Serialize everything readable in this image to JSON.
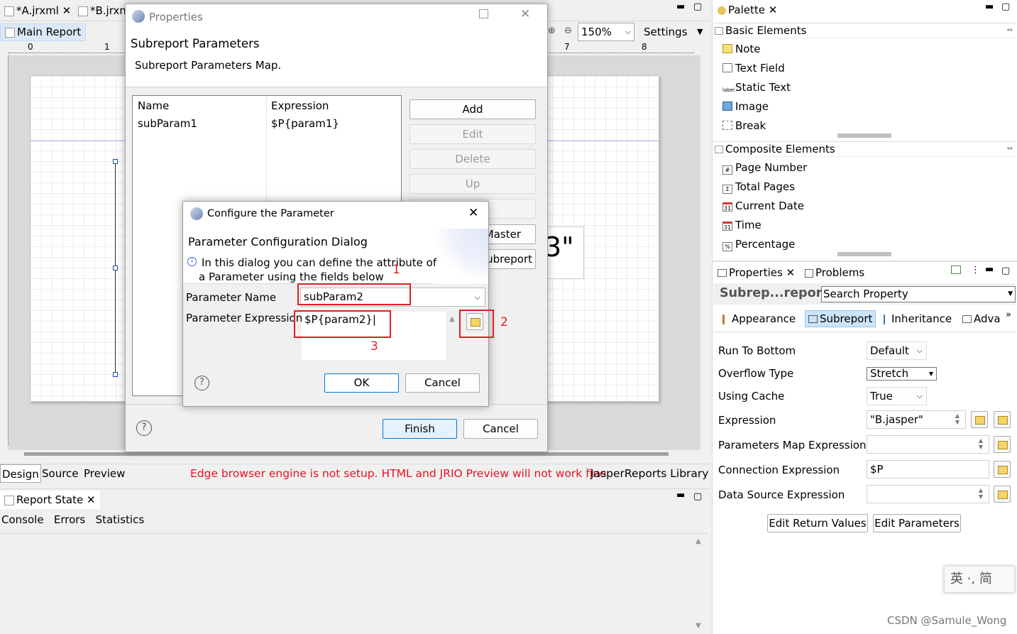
{
  "editor": {
    "tabs": [
      {
        "label": "*A.jrxml"
      },
      {
        "label": "*B.jrxm"
      }
    ],
    "subtab": "Main Report",
    "zoom": "150%",
    "settings": "Settings",
    "ruler_labels": [
      "0",
      "1",
      "7",
      "8"
    ],
    "preview_text": "3\"",
    "bottom_tabs": [
      "Design",
      "Source",
      "Preview"
    ],
    "warning": "Edge browser engine is not setup. HTML and JRIO Preview will not work fine",
    "library": "JasperReports Library"
  },
  "report_state": {
    "title": "Report State",
    "tabs": [
      "Console",
      "Errors",
      "Statistics"
    ]
  },
  "palette": {
    "title": "Palette",
    "basic_title": "Basic Elements",
    "basic": [
      {
        "label": "Note",
        "icon": "note-icon"
      },
      {
        "label": "Text Field",
        "icon": "text-field-icon"
      },
      {
        "label": "Static Text",
        "icon": "static-text-icon"
      },
      {
        "label": "Image",
        "icon": "image-icon"
      },
      {
        "label": "Break",
        "icon": "break-icon"
      }
    ],
    "composite_title": "Composite Elements",
    "composite": [
      {
        "label": "Page Number",
        "icon": "hash-icon",
        "glyph": "#"
      },
      {
        "label": "Total Pages",
        "icon": "sigma-icon",
        "glyph": "Σ"
      },
      {
        "label": "Current Date",
        "icon": "calendar-icon",
        "glyph": "31"
      },
      {
        "label": "Time",
        "icon": "calendar-icon",
        "glyph": "31"
      },
      {
        "label": "Percentage",
        "icon": "percent-icon",
        "glyph": "%"
      }
    ]
  },
  "properties_view": {
    "tabs": [
      "Properties",
      "Problems"
    ],
    "element_title": "Subrep...report",
    "search_placeholder": "Search Property",
    "section_tabs": [
      "Appearance",
      "Subreport",
      "Inheritance",
      "Adva"
    ],
    "fields": [
      {
        "label": "Run To Bottom",
        "value": "Default"
      },
      {
        "label": "Overflow Type",
        "value": "Stretch"
      },
      {
        "label": "Using Cache",
        "value": "True"
      },
      {
        "label": "Expression",
        "value": "\"B.jasper\""
      },
      {
        "label": "Parameters Map Expression",
        "value": ""
      },
      {
        "label": "Connection Expression",
        "value": "$P"
      },
      {
        "label": "Data Source Expression",
        "value": ""
      }
    ],
    "edit_return_values": "Edit Return Values",
    "edit_parameters": "Edit Parameters"
  },
  "properties_dialog": {
    "title": "Properties",
    "heading": "Subreport Parameters",
    "subheading": "Subreport Parameters Map.",
    "columns": [
      "Name",
      "Expression"
    ],
    "rows": [
      {
        "name": "subParam1",
        "expression": "$P{param1}"
      }
    ],
    "buttons": {
      "add": "Add",
      "edit": "Edit",
      "delete": "Delete",
      "up": "Up",
      "master": "Master",
      "subreport": "Subreport"
    },
    "finish": "Finish",
    "cancel": "Cancel"
  },
  "config_dialog": {
    "title": "Configure the Parameter",
    "heading": "Parameter Configuration Dialog",
    "info_line1": "In this dialog you can define the attribute of",
    "info_line2": "a Parameter using the fields below",
    "name_label": "Parameter Name",
    "name_value": "subParam2",
    "expr_label": "Parameter Expression",
    "expr_value": "$P{param2}",
    "ok": "OK",
    "cancel": "Cancel",
    "annotations": [
      "1",
      "2",
      "3"
    ]
  },
  "ime": {
    "text": "英 ·, 简"
  },
  "watermark": "CSDN @Samule_Wong",
  "colors": {
    "accent": "#0078d7",
    "annotation": "#e02020",
    "warning": "#e81123"
  }
}
